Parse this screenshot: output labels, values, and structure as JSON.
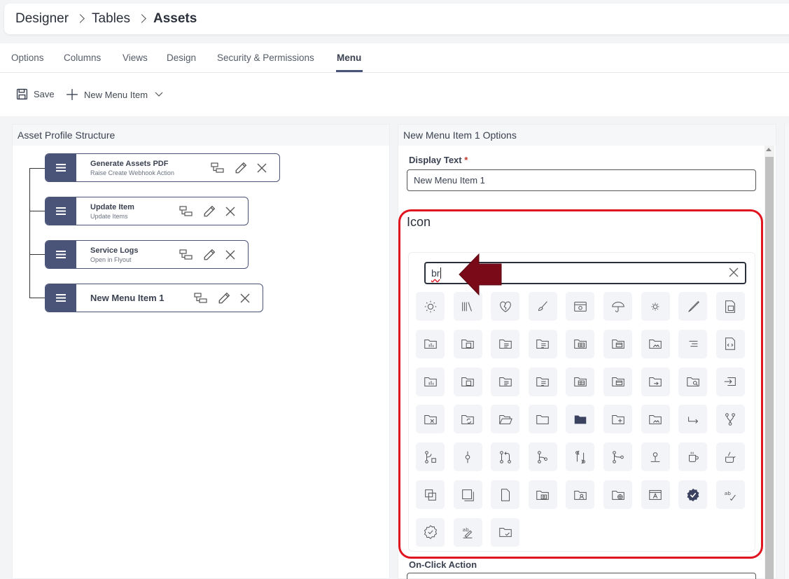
{
  "breadcrumb": {
    "items": [
      "Designer",
      "Tables"
    ],
    "current": "Assets"
  },
  "tabs": [
    {
      "label": "Options",
      "active": false
    },
    {
      "label": "Columns",
      "active": false
    },
    {
      "label": "Views",
      "active": false
    },
    {
      "label": "Design",
      "active": false
    },
    {
      "label": "Security & Permissions",
      "active": false
    },
    {
      "label": "Menu",
      "active": true
    }
  ],
  "toolbar": {
    "save_label": "Save",
    "new_item_label": "New Menu Item"
  },
  "left_panel": {
    "title": "Asset Profile Structure",
    "nodes": [
      {
        "title": "Generate Assets PDF",
        "subtitle": "Raise Create Webhook Action"
      },
      {
        "title": "Update Item",
        "subtitle": "Update Items"
      },
      {
        "title": "Service Logs",
        "subtitle": "Open in Flyout"
      },
      {
        "title": "New Menu Item 1",
        "subtitle": ""
      }
    ]
  },
  "right_panel": {
    "title": "New Menu Item 1 Options",
    "display_text_label": "Display Text",
    "required_marker": "*",
    "display_text_value": "New Menu Item 1",
    "icon_label": "Icon",
    "icon_search_value": "br",
    "on_click_label": "On-Click Action"
  },
  "icons": [
    "brightness-high-icon",
    "bookshelf-icon",
    "heartbreak-icon",
    "brush-icon",
    "camera-browser-icon",
    "umbrella-icon",
    "brightness-low-icon",
    "brush-fine-icon",
    "file-earmark-code-icon",
    "folder-bar-chart-icon",
    "folder-doc-icon",
    "folder-text-icon",
    "folder-list-icon",
    "folder-table-icon",
    "folder-table-alt-icon",
    "folder-image-icon",
    "text-right-icon",
    "file-code-alt-icon",
    "folder-bar-chart-alt-icon",
    "folder-doc-alt-icon",
    "folder-text-alt-icon",
    "folder-list-alt-icon",
    "folder-table-2-icon",
    "folder-table-3-icon",
    "folder-sync-icon",
    "folder-search-icon",
    "box-arrow-in-right-icon",
    "folder-x-icon",
    "folder-refresh-icon",
    "folder-open-icon",
    "folder-icon",
    "folder-fill-icon",
    "folder-plus-icon",
    "folder-image-alt-icon",
    "arrow-return-right-icon",
    "git-fork-icon",
    "git-branch-lock-icon",
    "git-commit-icon",
    "git-pull-request-icon",
    "git-branch-icon",
    "git-compare-icon",
    "git-merge-icon",
    "git-pull-icon",
    "mug-icon",
    "pot-icon",
    "copy-icon",
    "square-shadow-icon",
    "file-blank-icon",
    "folder-camera-icon",
    "folder-user-icon",
    "folder-globe-icon",
    "window-a-icon",
    "patch-check-fill-icon",
    "spellcheck-icon",
    "patch-check-icon",
    "text-edit-icon",
    "folder-check-icon"
  ],
  "colors": {
    "accent": "#4a5478",
    "highlight": "#e0151f",
    "arrow": "#7a0a18"
  }
}
